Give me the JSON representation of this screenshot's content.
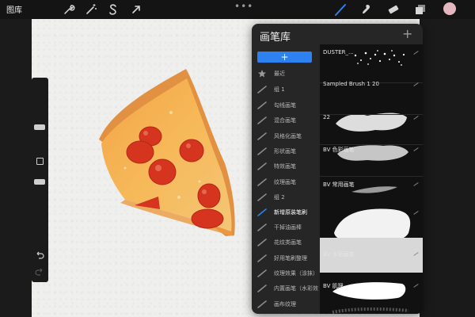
{
  "topbar": {
    "gallery_label": "图库",
    "left_tools": [
      "wrench-icon",
      "magic-wand-icon",
      "selection-s-icon",
      "transform-arrow-icon"
    ],
    "more_label": "•••",
    "right_tools": [
      "brush-icon",
      "smudge-icon",
      "eraser-icon",
      "layers-icon",
      "color-swatch"
    ],
    "active_tool": "brush-icon",
    "accent": "#2d82f0",
    "swatch_color": "#e4b7c0"
  },
  "panel": {
    "title": "画笔库",
    "plus": "+",
    "add_button": "+"
  },
  "categories": [
    {
      "label": "最近",
      "icon": "star-icon"
    },
    {
      "label": "组 1",
      "icon": "brush-stroke-icon"
    },
    {
      "label": "勾线画笔",
      "icon": "brush-stroke-icon"
    },
    {
      "label": "混合画笔",
      "icon": "brush-stroke-icon"
    },
    {
      "label": "风格化画笔",
      "icon": "brush-stroke-icon"
    },
    {
      "label": "形状画笔",
      "icon": "brush-stroke-icon"
    },
    {
      "label": "特效画笔",
      "icon": "brush-stroke-icon"
    },
    {
      "label": "纹理画笔",
      "icon": "brush-stroke-icon"
    },
    {
      "label": "组 2",
      "icon": "brush-stroke-icon"
    },
    {
      "label": "新增原装笔刷",
      "icon": "brush-stroke-icon",
      "active": true
    },
    {
      "label": "干掉油画棒",
      "icon": "brush-stroke-icon"
    },
    {
      "label": "花纹类画笔",
      "icon": "brush-stroke-icon"
    },
    {
      "label": "好用笔刷整理",
      "icon": "brush-stroke-icon"
    },
    {
      "label": "纹理效果（涂抹）",
      "icon": "brush-stroke-icon"
    },
    {
      "label": "内置画笔（水彩效果）...",
      "icon": "brush-stroke-icon"
    },
    {
      "label": "画布纹理",
      "icon": "brush-stroke-icon"
    }
  ],
  "brushes": [
    {
      "name": "DUSTER_..."
    },
    {
      "name": "Sampled Brush 1 20"
    },
    {
      "name": "22"
    },
    {
      "name": "BV 色彩画笔"
    },
    {
      "name": "BV 常用画笔"
    },
    {
      "name": ""
    },
    {
      "name": "BV 水彩画笔"
    },
    {
      "name": "BV 肌理"
    }
  ]
}
